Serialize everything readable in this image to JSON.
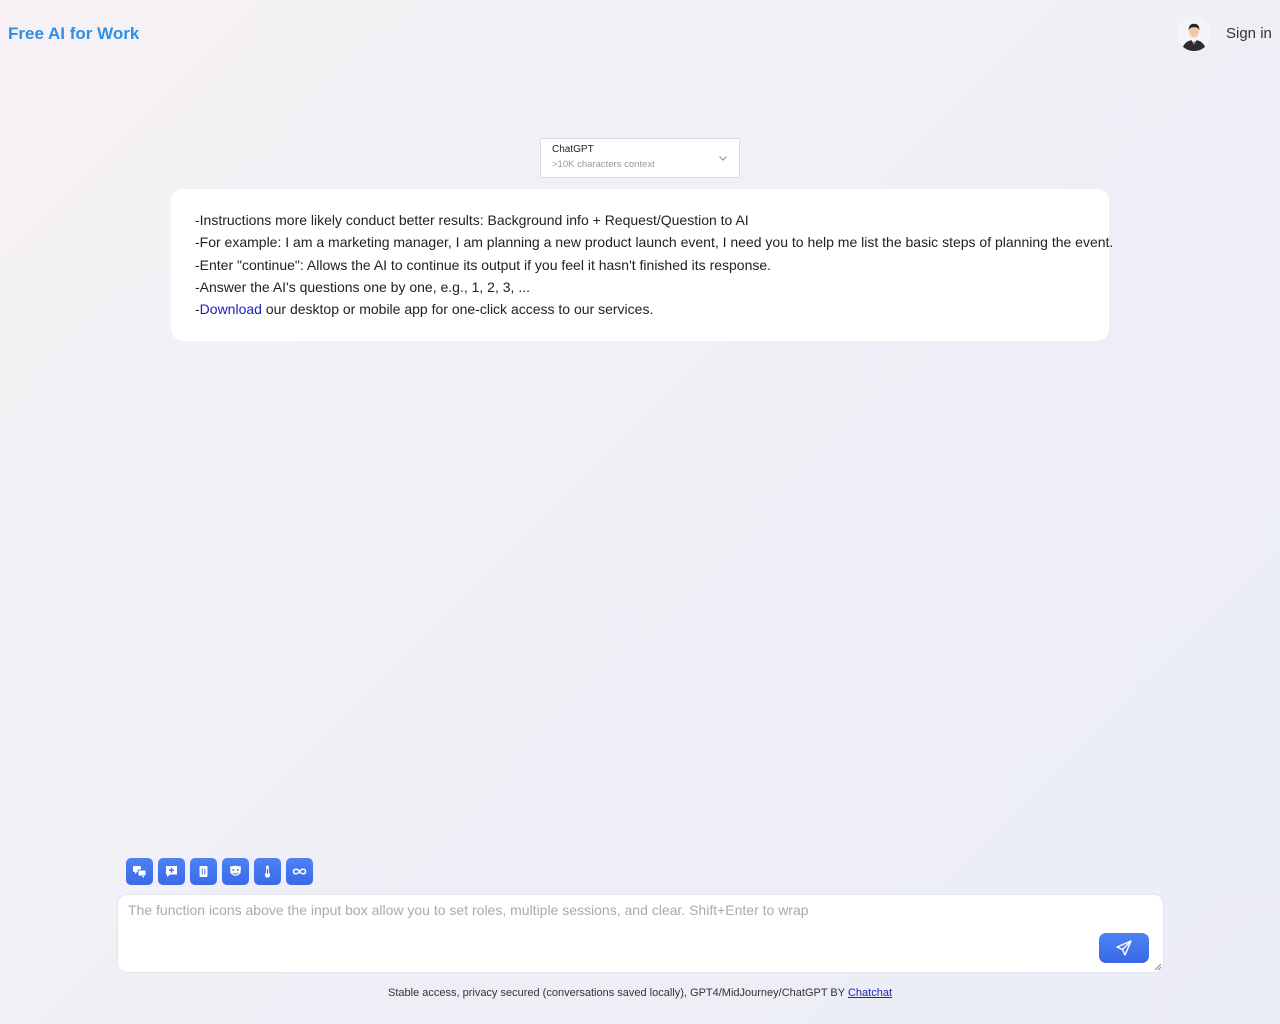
{
  "header": {
    "brand": "Free AI for Work",
    "sign_in": "Sign in"
  },
  "model_selector": {
    "name": "ChatGPT",
    "subtitle": ">10K characters context"
  },
  "tips": {
    "line1": "-Instructions more likely conduct better results: Background info + Request/Question to AI",
    "line2": "-For example: I am a marketing manager, I am planning a new product launch event, I need you to help me list the basic steps of planning the event.",
    "line3": "-Enter \"continue\": Allows the AI to continue its output if you feel it hasn't finished its response.",
    "line4": "-Answer the AI's questions one by one, e.g., 1, 2, 3, ...",
    "line5_prefix": "-",
    "line5_link": "Download",
    "line5_suffix": " our desktop or mobile app for one-click access to our services."
  },
  "toolbar": {
    "icons": [
      "sessions-icon",
      "new-chat-icon",
      "clear-icon",
      "role-mask-icon",
      "temperature-icon",
      "continuous-icon"
    ]
  },
  "input": {
    "placeholder": "The function icons above the input box allow you to set roles, multiple sessions, and clear. Shift+Enter to wrap"
  },
  "footer": {
    "text": "Stable access, privacy secured (conversations saved locally), GPT4/MidJourney/ChatGPT BY ",
    "link": "Chatchat"
  },
  "colors": {
    "brand": "#2f8fe6",
    "accent": "#3f70ec",
    "link": "#1a22b8"
  }
}
